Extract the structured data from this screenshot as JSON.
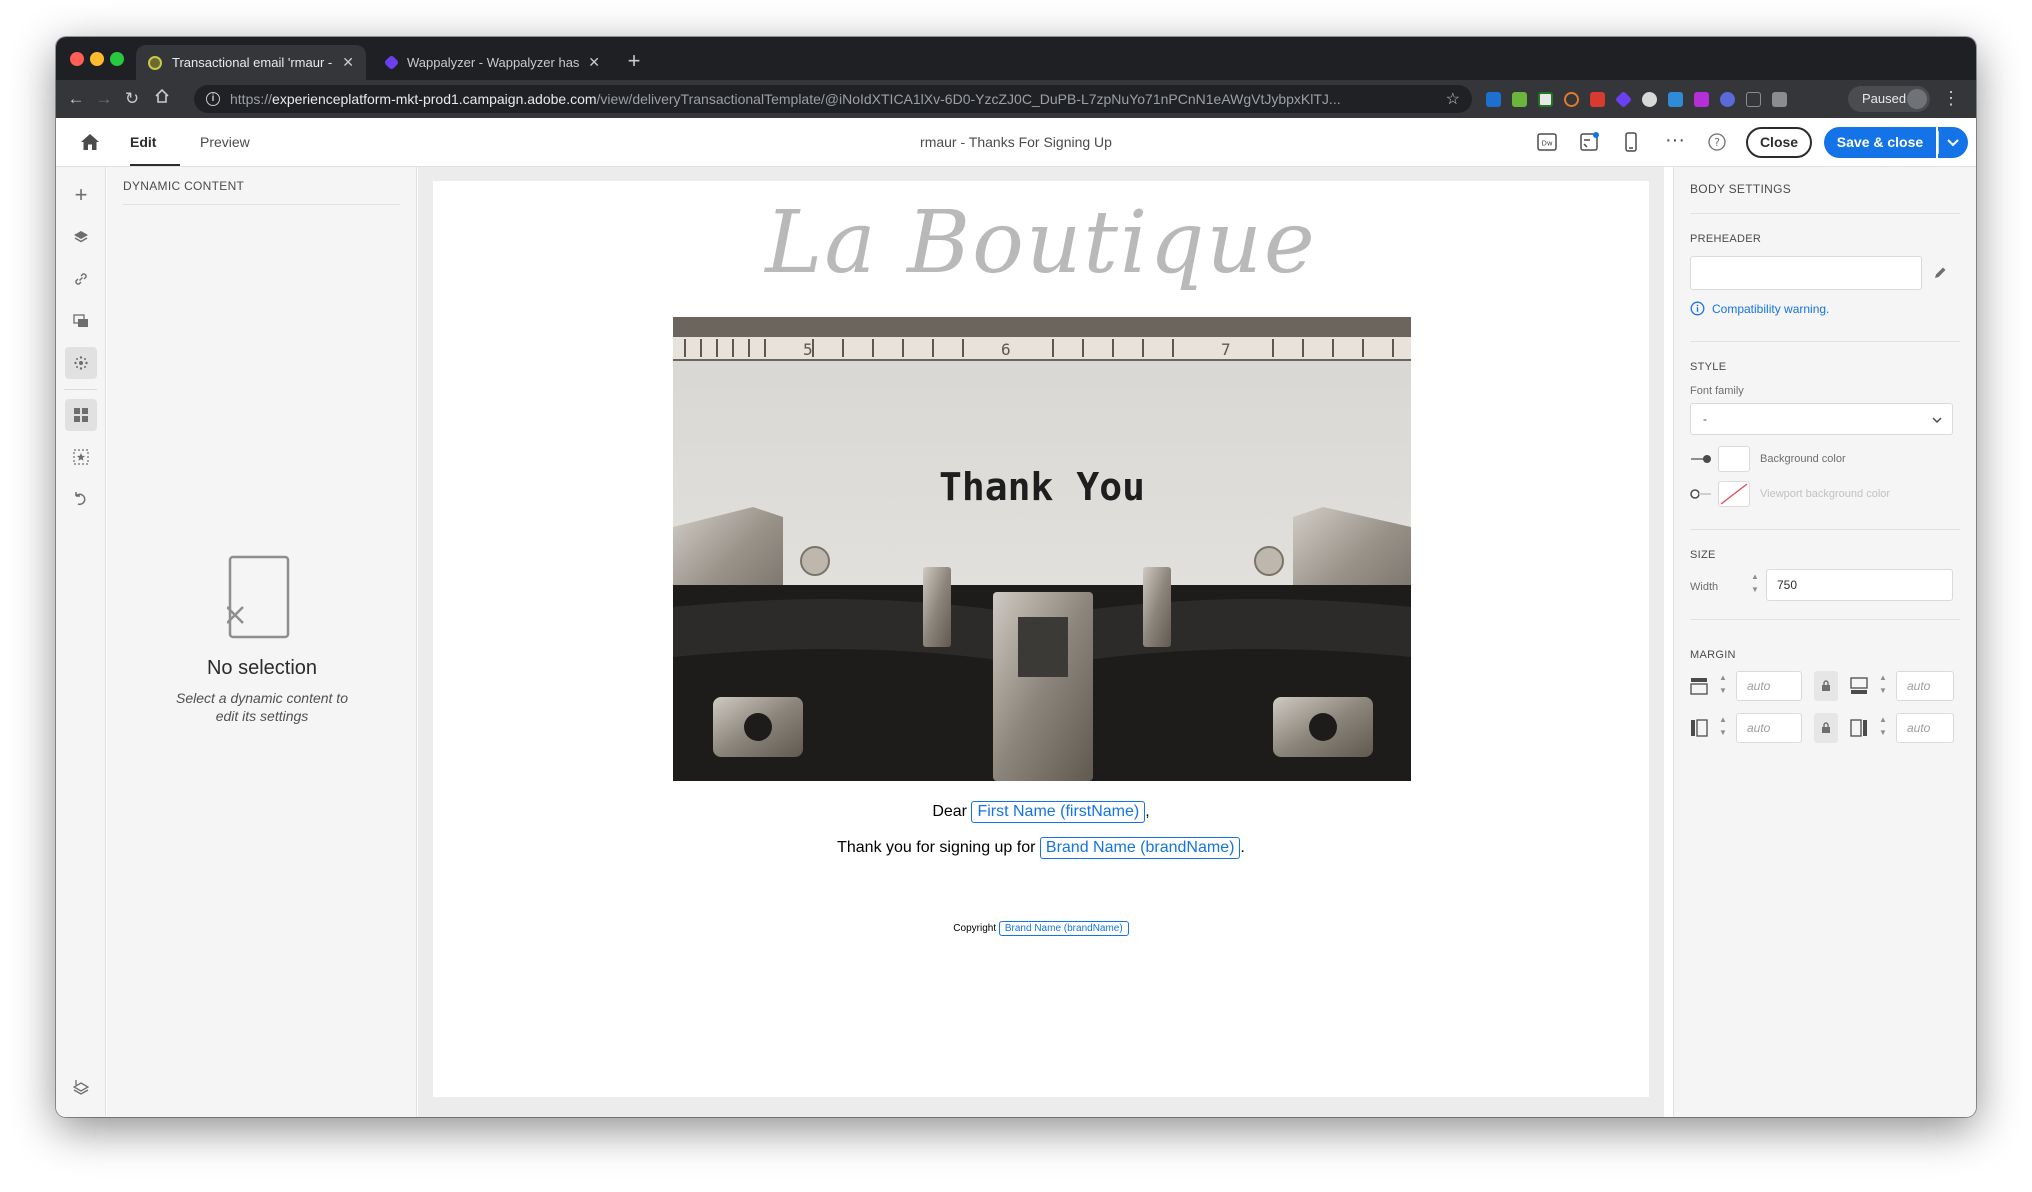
{
  "browser": {
    "tabs": [
      {
        "title": "Transactional email 'rmaur - Th",
        "active": true
      },
      {
        "title": "Wappalyzer - Wappalyzer has b",
        "active": false
      }
    ],
    "url_prefix": "https://",
    "url_host": "experienceplatform-mkt-prod1.campaign.adobe.com",
    "url_path": "/view/deliveryTransactionalTemplate/@iNoIdXTICA1lXv-6D0-YzcZJ0C_DuPB-L7zpNuYo71nPCnN1eAWgVtJybpxKlTJ...",
    "profile_status": "Paused",
    "extension_icons": [
      "svg-icon",
      "chart-icon",
      "k-icon",
      "circle-icon",
      "shield-icon",
      "diamond-icon",
      "globe-icon",
      "hash-icon",
      "purple-icon",
      "bars-icon",
      "square-icon",
      "camera-icon"
    ]
  },
  "header": {
    "tabs": [
      {
        "label": "Edit",
        "active": true
      },
      {
        "label": "Preview",
        "active": false
      }
    ],
    "document_title": "rmaur - Thanks For Signing Up",
    "close_label": "Close",
    "save_label": "Save & close"
  },
  "left_panel": {
    "heading": "DYNAMIC CONTENT",
    "empty_title": "No selection",
    "empty_description": "Select a dynamic content to edit its settings"
  },
  "email": {
    "logo_text": "La Boutique",
    "hero_text": "Thank You",
    "greeting_prefix": "Dear ",
    "greeting_field": "First Name (firstName)",
    "greeting_suffix": ",",
    "body_prefix": "Thank you for signing up for ",
    "body_field": "Brand Name (brandName)",
    "body_suffix": ".",
    "footer_prefix": "Copyright ",
    "footer_field": "Brand Name (brandName)"
  },
  "right_panel": {
    "heading": "BODY SETTINGS",
    "preheader_label": "PREHEADER",
    "preheader_value": "",
    "compat_warning": "Compatibility warning.",
    "style_label": "STYLE",
    "font_family_label": "Font family",
    "font_family_value": "-",
    "background_color_label": "Background color",
    "viewport_bg_label": "Viewport background color",
    "size_label": "SIZE",
    "width_label": "Width",
    "width_value": "750",
    "margin_label": "MARGIN",
    "margin_values": [
      "auto",
      "auto",
      "auto",
      "auto"
    ]
  },
  "colors": {
    "accent": "#1473e6",
    "chrome_dark": "#1f2023",
    "chrome_toolbar": "#35363a"
  }
}
